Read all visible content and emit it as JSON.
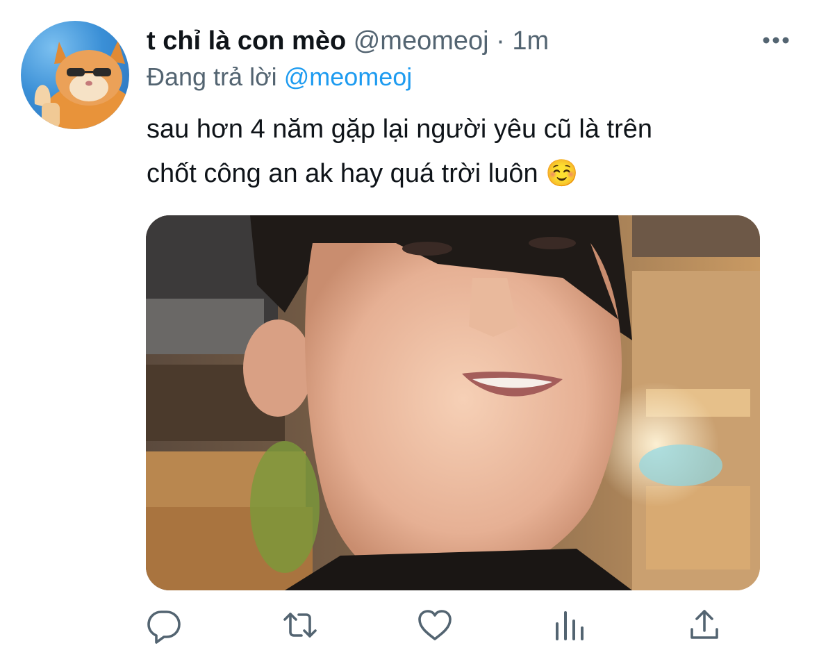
{
  "tweet": {
    "display_name": "t chỉ là con mèo",
    "handle": "@meomeoj",
    "separator": "·",
    "time": "1m",
    "reply_prefix": "Đang trả lời",
    "reply_to": "@meomeoj",
    "text_line1": "sau hơn 4 năm gặp lại người yêu cũ là trên",
    "text_line2": "chốt công an ak hay quá trời luôn ☺️"
  },
  "icons": {
    "more": "more-horizontal-icon",
    "reply": "reply-icon",
    "retweet": "retweet-icon",
    "like": "heart-icon",
    "analytics": "analytics-icon",
    "share": "share-icon"
  },
  "colors": {
    "text": "#0f1419",
    "secondary": "#536471",
    "accent": "#1d9bf0",
    "icon": "#536471"
  }
}
